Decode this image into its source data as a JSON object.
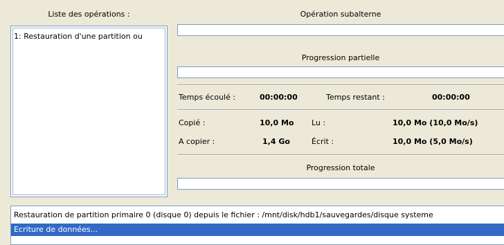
{
  "operations": {
    "heading": "Liste des opérations :",
    "items": [
      "1: Restauration d'une partition ou"
    ]
  },
  "sub_operation": {
    "heading": "Opération subalterne"
  },
  "partial_progress": {
    "heading": "Progression partielle",
    "value": 0
  },
  "time": {
    "elapsed_label": "Temps écoulé :",
    "elapsed_value": "00:00:00",
    "remaining_label": "Temps restant :",
    "remaining_value": "00:00:00"
  },
  "stats": {
    "copied_label": "Copié :",
    "copied_value": "10,0 Mo",
    "to_copy_label": "A copier :",
    "to_copy_value": "1,4 Go",
    "read_label": "Lu :",
    "read_value": "10,0 Mo (10,0 Mo/s)",
    "written_label": "Écrit :",
    "written_value": "10,0 Mo (5,0 Mo/s)"
  },
  "total_progress": {
    "heading": "Progression totale",
    "value": 0
  },
  "log": {
    "lines": [
      "Restauration de partition primaire 0 (disque 0) depuis le fichier : /mnt/disk/hdb1/sauvegardes/disque systeme",
      "Ecriture de données..."
    ]
  },
  "colors": {
    "selection": "#316ac5",
    "background": "#ece9d8",
    "border": "#7f9db9"
  }
}
